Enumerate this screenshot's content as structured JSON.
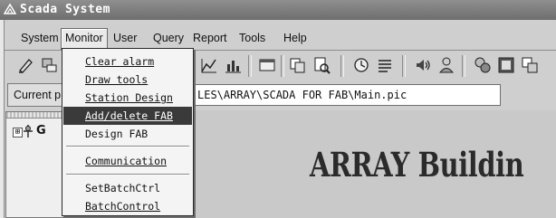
{
  "window": {
    "title": "Scada System"
  },
  "menubar": [
    {
      "label": "System"
    },
    {
      "label": "Monitor"
    },
    {
      "label": "User"
    },
    {
      "label": "Query"
    },
    {
      "label": "Report"
    },
    {
      "label": "Tools"
    },
    {
      "label": "Help"
    }
  ],
  "monitor_menu": {
    "items": [
      {
        "label": "Clear alarm"
      },
      {
        "label": "Draw tools"
      },
      {
        "label": "Station Design"
      },
      {
        "label": "Add/delete FAB",
        "highlighted": true
      },
      {
        "label": "Design FAB"
      },
      {
        "label": "Communication"
      },
      {
        "label": "SetBatchCtrl"
      },
      {
        "label": "BatchControl"
      }
    ]
  },
  "pathbar": {
    "label": "Current p",
    "value": "LES\\ARRAY\\SCADA FOR FAB\\Main.pic"
  },
  "tree": {
    "expander": "⊞",
    "root_label": "G"
  },
  "canvas": {
    "title": "ARRAY Buildin"
  },
  "toolbar_icons": [
    "pen-icon",
    "station-icon",
    "chart-icon",
    "bar-chart-icon",
    "window-icon",
    "copy-icon",
    "print-preview-icon",
    "clock-icon",
    "list-icon",
    "sound-icon",
    "user-icon",
    "network-icon",
    "screen-icon",
    "windows-icon"
  ]
}
